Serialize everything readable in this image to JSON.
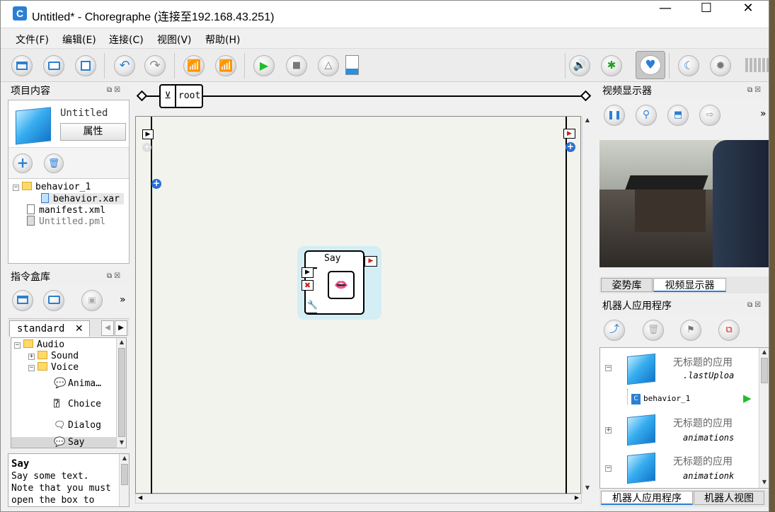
{
  "window": {
    "title": "Untitled* - Choregraphe (连接至192.168.43.251)",
    "app_icon": "C",
    "minimize": "—",
    "maximize": "☐",
    "close": "✕"
  },
  "menu": [
    "文件(F)",
    "编辑(E)",
    "连接(C)",
    "视图(V)",
    "帮助(H)"
  ],
  "toolbar_icons": [
    "new-project-icon",
    "open-project-icon",
    "save-icon",
    "undo-icon",
    "redo-icon",
    "connect-icon",
    "disconnect-icon",
    "play-icon",
    "stop-icon",
    "debug-icon",
    "battery-level-icon",
    "volume-icon",
    "stiffness-icon",
    "autonomous-life-icon",
    "rest-icon",
    "settings-icon",
    "battery-icon"
  ],
  "project_panel": {
    "title": "项目内容",
    "project_name": "Untitled",
    "properties_button": "属性",
    "tree": [
      "behavior_1",
      "behavior.xar",
      "manifest.xml",
      "Untitled.pml"
    ]
  },
  "library_panel": {
    "title": "指令盒库",
    "tab": "standard",
    "tab_close": "✕",
    "tree": [
      "Audio",
      "Sound",
      "Voice",
      "Anima…",
      "Choice",
      "Dialog",
      "Say"
    ]
  },
  "description": {
    "title": "Say",
    "lines": [
      "Say some text.",
      "Note that you must",
      "open the box to"
    ]
  },
  "flow": {
    "breadcrumb": "root",
    "box_label": "Say"
  },
  "video_panel": {
    "title": "视频显示器",
    "tabs": [
      "姿势库",
      "视频显示器"
    ]
  },
  "apps_panel": {
    "title": "机器人应用程序",
    "items": [
      {
        "name": "无标题的应用",
        "sub": ".lastUploa"
      },
      {
        "name": "无标题的应用",
        "sub": "animations"
      },
      {
        "name": "无标题的应用",
        "sub": "animationk"
      }
    ],
    "behavior": "behavior_1",
    "tabs": [
      "机器人应用程序",
      "机器人视图"
    ]
  },
  "colors": {
    "accent": "#2b7fd3",
    "canvas": "#f3f3ed",
    "box_highlight": "#d3eef4",
    "play_green": "#1fbf2a"
  },
  "overflow": "»"
}
